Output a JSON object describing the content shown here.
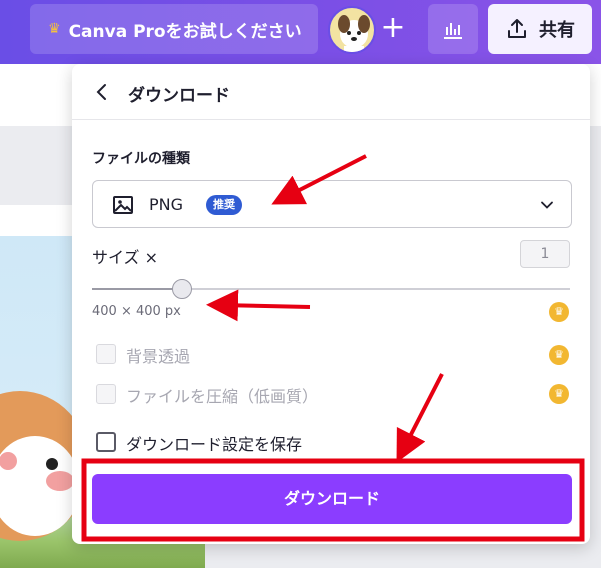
{
  "topbar": {
    "pro_button_label": "Canva Proをお試しください",
    "share_label": "共有",
    "plus_label": "+"
  },
  "panel": {
    "title": "ダウンロード",
    "file_type_label": "ファイルの種類",
    "file_type_value": "PNG",
    "file_type_badge": "推奨",
    "size_label": "サイズ ×",
    "size_value": "1",
    "dimensions_text": "400 × 400 px",
    "size_slider_value": 1,
    "options": [
      {
        "label": "背景透過",
        "checked": false,
        "pro": true
      },
      {
        "label": "ファイルを圧縮（低画質）",
        "checked": false,
        "pro": true
      },
      {
        "label": "ダウンロード設定を保存",
        "checked": false,
        "pro": false
      }
    ],
    "download_button_label": "ダウンロード"
  },
  "icons": {
    "crown": "crown-icon",
    "back": "chevron-left-icon",
    "image": "image-icon",
    "dropdown": "chevron-down-icon",
    "share": "share-upload-icon",
    "insights": "bar-chart-icon"
  },
  "colors": {
    "topbar_start": "#6a4ee6",
    "topbar_end": "#8a54e8",
    "download_button": "#8b3dff",
    "badge": "#2f5bd3",
    "crown": "#f2b731",
    "annotation_red": "#e60012"
  }
}
